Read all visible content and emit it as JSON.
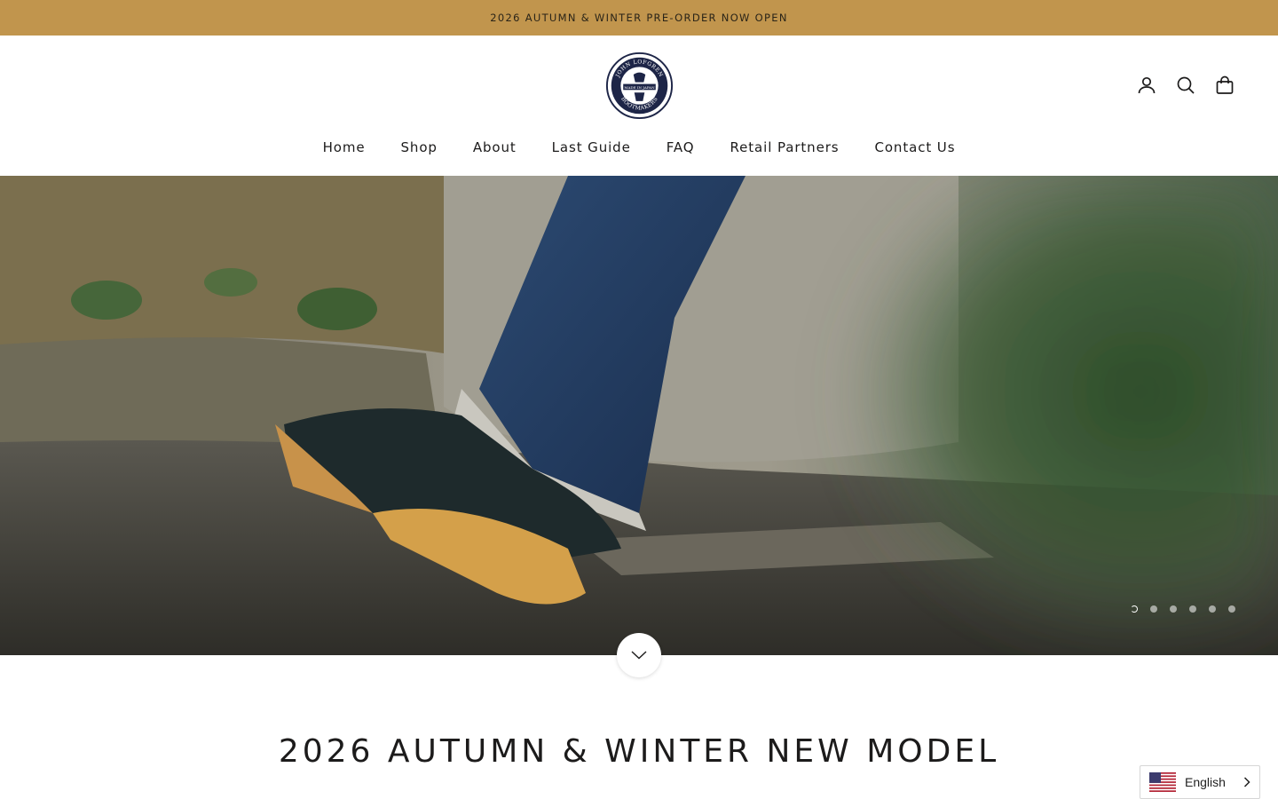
{
  "announcement": {
    "text": "2026 AUTUMN & WINTER PRE-ORDER NOW OPEN"
  },
  "brand": {
    "logo_text_top": "JOHN LOFGREN",
    "logo_text_middle": "MADE IN JAPAN",
    "logo_text_bottom": "BOOTMAKERS"
  },
  "header": {
    "icons": [
      "account-icon",
      "search-icon",
      "cart-icon"
    ]
  },
  "nav": {
    "items": [
      {
        "label": "Home"
      },
      {
        "label": "Shop"
      },
      {
        "label": "About"
      },
      {
        "label": "Last Guide"
      },
      {
        "label": "FAQ"
      },
      {
        "label": "Retail Partners"
      },
      {
        "label": "Contact Us"
      }
    ]
  },
  "hero": {
    "slide_count": 6,
    "active_slide": 1
  },
  "section": {
    "title": "2026 AUTUMN & WINTER NEW MODEL"
  },
  "language": {
    "selected": "English"
  },
  "colors": {
    "announcement_bg": "#c1954d",
    "text": "#1c1b1b"
  }
}
